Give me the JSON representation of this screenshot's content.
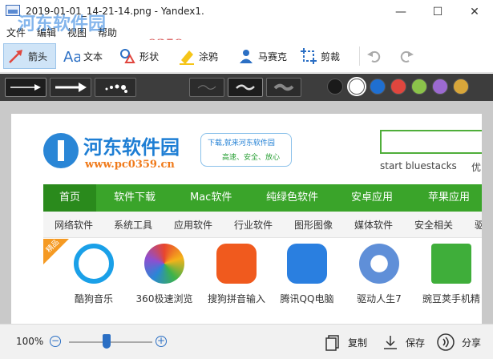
{
  "window": {
    "title": "2019-01-01_14-21-14.png - Yandex1.",
    "minimize_glyph": "—",
    "maximize_glyph": "☐",
    "close_glyph": "✕"
  },
  "menu": [
    "文件",
    "编辑",
    "视图",
    "帮助"
  ],
  "watermark": {
    "text": "河东软件园",
    "url": "www.pc0359.cn"
  },
  "tools": [
    {
      "label": "箭头",
      "icon": "arrow-tool-icon",
      "active": true
    },
    {
      "label": "文本",
      "icon": "text-tool-icon"
    },
    {
      "label": "形状",
      "icon": "shape-tool-icon"
    },
    {
      "label": "涂鸦",
      "icon": "marker-tool-icon"
    },
    {
      "label": "马赛克",
      "icon": "blur-person-icon"
    },
    {
      "label": "剪裁",
      "icon": "crop-tool-icon"
    }
  ],
  "history": {
    "undo_icon": "undo-icon",
    "redo_icon": "redo-icon"
  },
  "options": {
    "arrow_styles": [
      "thin-arrow",
      "thick-arrow",
      "dotted-arrow"
    ],
    "line_widths": [
      "thin",
      "medium",
      "thick"
    ],
    "colors": [
      "#1a1a1a",
      "#ffffff",
      "#1f6fd1",
      "#e0463e",
      "#8bc34a",
      "#9c6ad1",
      "#d8a63a"
    ],
    "selected_color": "#ffffff"
  },
  "screenshot": {
    "logo_cn": "河东软件园",
    "logo_url": "www.pc0359.cn",
    "slogan_line1": "下载,就来河东软件园",
    "slogan_line2": "高速、安全、放心",
    "search_hint": "start bluestacks",
    "search_hint2": "优",
    "nav": [
      "首页",
      "软件下载",
      "Mac软件",
      "纯绿色软件",
      "安卓应用",
      "苹果应用"
    ],
    "subnav": [
      "网络软件",
      "系统工具",
      "应用软件",
      "行业软件",
      "图形图像",
      "媒体软件",
      "安全相关",
      "驱"
    ],
    "badge": "精品",
    "apps": [
      {
        "name": "酷狗音乐",
        "color": "#1aa0e8"
      },
      {
        "name": "360极速浏览",
        "color": "#e8a020"
      },
      {
        "name": "搜狗拼音输入",
        "color": "#f05a1e"
      },
      {
        "name": "腾讯QQ电脑",
        "color": "#2a7fe0"
      },
      {
        "name": "驱动人生7",
        "color": "#5f8fd8"
      },
      {
        "name": "豌豆荚手机精",
        "color": "#3fae3a"
      }
    ]
  },
  "status": {
    "zoom": "100%",
    "zoom_out": "−",
    "zoom_in": "+",
    "zoom_level": 0.45,
    "copy": "复制",
    "save": "保存",
    "share": "分享"
  }
}
